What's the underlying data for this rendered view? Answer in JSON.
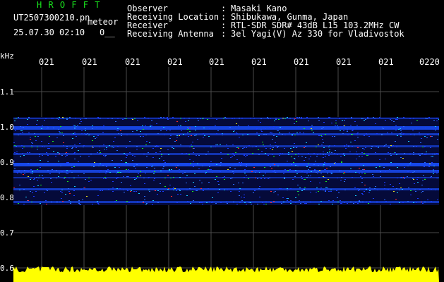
{
  "header": {
    "title": "H R O F F T",
    "filename": "UT2507300210.pn",
    "meteor_label": "meteor",
    "datetime": "25.07.30 02:10",
    "count_code": "0__"
  },
  "info": [
    {
      "label": "Observer",
      "value": "Masaki Kano"
    },
    {
      "label": "Receiving Location",
      "value": "Shibukawa, Gunma, Japan"
    },
    {
      "label": "Receiver",
      "value": "RTL-SDR SDR# 43dB L15 103.2MHz CW"
    },
    {
      "label": "Receiving Antenna",
      "value": "3el Yagi(V) Az 330 for Vladivostok"
    }
  ],
  "info_separator": ":",
  "axis": {
    "unit": "kHz",
    "time_ticks": [
      "021",
      "021",
      "021",
      "021",
      "021",
      "021",
      "021",
      "021",
      "021",
      "0220"
    ],
    "freq_ticks": [
      "1.1",
      "1.0",
      "0.9",
      "0.8",
      "0.7",
      "0.6"
    ]
  },
  "colors": {
    "background": "#000000",
    "title": "#19e61e",
    "grid": "#4a4a4a",
    "power": "#ffff00"
  }
}
